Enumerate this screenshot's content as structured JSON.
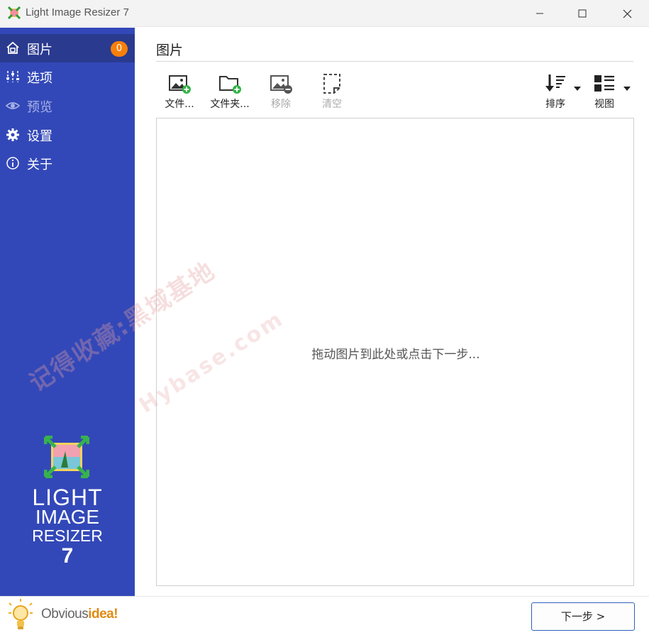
{
  "window": {
    "title": "Light Image Resizer 7"
  },
  "sidebar": {
    "items": [
      {
        "label": "图片",
        "icon": "home-icon",
        "badge": "0"
      },
      {
        "label": "选项",
        "icon": "sliders-icon"
      },
      {
        "label": "预览",
        "icon": "eye-icon"
      },
      {
        "label": "设置",
        "icon": "gear-icon"
      },
      {
        "label": "关于",
        "icon": "info-icon"
      }
    ],
    "brand": {
      "line1": "LIGHT",
      "line2": "IMAGE",
      "line3": "RESIZER",
      "line4": "7"
    },
    "footer": {
      "text_regular": "Obvious",
      "text_bold": "idea!"
    }
  },
  "main": {
    "section_title": "图片",
    "toolbar": {
      "add_files": "文件...",
      "add_folder": "文件夹...",
      "remove": "移除",
      "clear": "清空",
      "sort": "排序",
      "view": "视图"
    },
    "drop_hint": "拖动图片到此处或点击下一步...",
    "next_button": "下一步 >"
  },
  "watermark": {
    "line1": "记得收藏:黑域基地",
    "line2": "Hybase.com"
  },
  "colors": {
    "sidebar_bg": "#3348b8",
    "sidebar_active": "#2a3a8f",
    "badge": "#f7800b",
    "button_border": "#2f5fbf"
  }
}
